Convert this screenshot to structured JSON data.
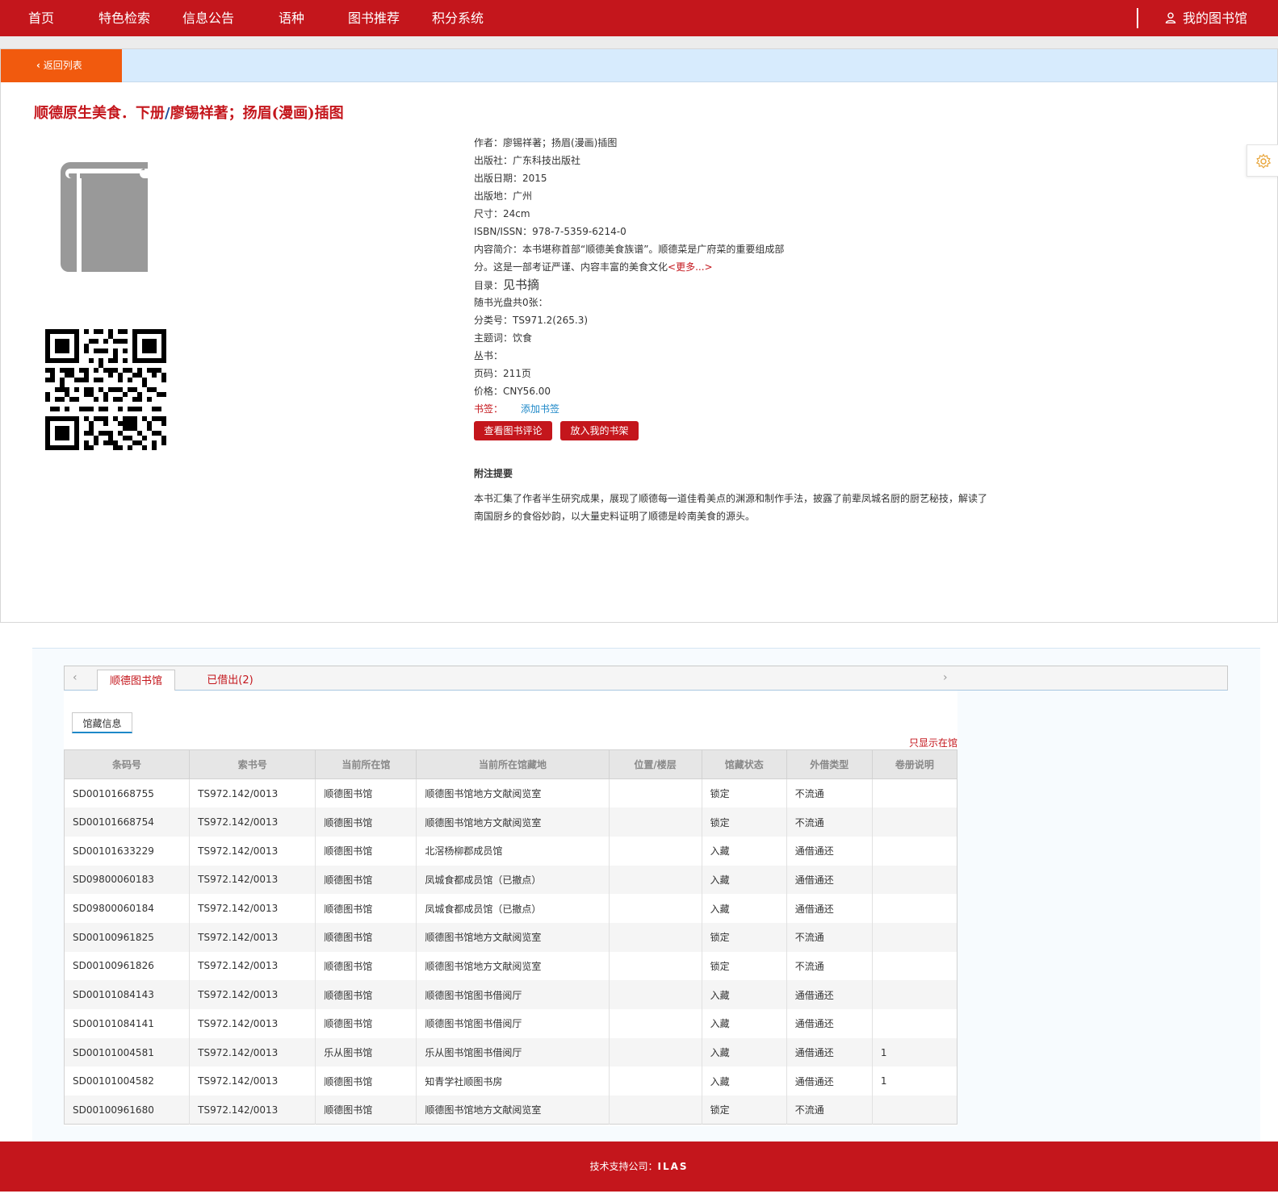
{
  "nav": {
    "items": [
      {
        "label": "首页",
        "name": "nav-home"
      },
      {
        "label": "特色检索",
        "name": "nav-special-search"
      },
      {
        "label": "信息公告",
        "name": "nav-announcements"
      },
      {
        "label": "语种",
        "name": "nav-language"
      },
      {
        "label": "图书推荐",
        "name": "nav-book-recommend"
      },
      {
        "label": "积分系统",
        "name": "nav-points"
      }
    ],
    "my_library": "我的图书馆"
  },
  "back_label": "返回列表",
  "book": {
    "title_main": "顺德原生美食．下册",
    "title_slash": "/",
    "title_author": "廖锡祥著；扬眉(漫画)插图"
  },
  "meta": {
    "author": "作者：廖锡祥著；扬眉(漫画)插图",
    "publisher": "出版社：广东科技出版社",
    "pub_date": "出版日期：2015",
    "pub_place": "出版地：广州",
    "size": "尺寸：24cm",
    "isbn": "ISBN/ISSN：978-7-5359-6214-0",
    "summary_1": "内容简介：本书堪称首部“顺德美食族谱”。顺德菜是广府菜的重要组成部",
    "summary_2": "分。这是一部考证严谨、内容丰富的美食文化",
    "more": "<更多...>",
    "toc_label": "目录：",
    "toc_value": "见书摘",
    "disc": "随书光盘共0张：",
    "class_no": "分类号：TS971.2(265.3)",
    "subject": "主题词：饮食",
    "series": "丛书：",
    "pages": "页码：211页",
    "price": "价格：CNY56.00",
    "bookmark_label": "书签：",
    "bookmark_add": "添加书签"
  },
  "actions": {
    "view_reviews": "查看图书评论",
    "add_shelf": "放入我的书架"
  },
  "notes": {
    "title": "附注提要",
    "text": "本书汇集了作者半生研究成果，展现了顺德每一道佳肴美点的渊源和制作手法，披露了前辈凤城名厨的厨艺秘技，解读了南国厨乡的食俗妙韵，以大量史料证明了顺德是岭南美食的源头。"
  },
  "holdings": {
    "tabs": [
      {
        "label": "顺德图书馆",
        "active": true
      },
      {
        "label": "已借出(2)",
        "active": false
      }
    ],
    "subtab": "馆藏信息",
    "only_show": "只显示在馆",
    "columns": [
      "条码号",
      "索书号",
      "当前所在馆",
      "当前所在馆藏地",
      "位置/楼层",
      "馆藏状态",
      "外借类型",
      "卷册说明"
    ],
    "rows": [
      [
        "SD00101668755",
        "TS972.142/0013",
        "顺德图书馆",
        "顺德图书馆地方文献阅览室",
        "",
        "锁定",
        "不流通",
        ""
      ],
      [
        "SD00101668754",
        "TS972.142/0013",
        "顺德图书馆",
        "顺德图书馆地方文献阅览室",
        "",
        "锁定",
        "不流通",
        ""
      ],
      [
        "SD00101633229",
        "TS972.142/0013",
        "顺德图书馆",
        "北滘杨柳郡成员馆",
        "",
        "入藏",
        "通借通还",
        ""
      ],
      [
        "SD09800060183",
        "TS972.142/0013",
        "顺德图书馆",
        "凤城食都成员馆（已撤点）",
        "",
        "入藏",
        "通借通还",
        ""
      ],
      [
        "SD09800060184",
        "TS972.142/0013",
        "顺德图书馆",
        "凤城食都成员馆（已撤点）",
        "",
        "入藏",
        "通借通还",
        ""
      ],
      [
        "SD00100961825",
        "TS972.142/0013",
        "顺德图书馆",
        "顺德图书馆地方文献阅览室",
        "",
        "锁定",
        "不流通",
        ""
      ],
      [
        "SD00100961826",
        "TS972.142/0013",
        "顺德图书馆",
        "顺德图书馆地方文献阅览室",
        "",
        "锁定",
        "不流通",
        ""
      ],
      [
        "SD00101084143",
        "TS972.142/0013",
        "顺德图书馆",
        "顺德图书馆图书借阅厅",
        "",
        "入藏",
        "通借通还",
        ""
      ],
      [
        "SD00101084141",
        "TS972.142/0013",
        "顺德图书馆",
        "顺德图书馆图书借阅厅",
        "",
        "入藏",
        "通借通还",
        ""
      ],
      [
        "SD00101004581",
        "TS972.142/0013",
        "乐从图书馆",
        "乐从图书馆图书借阅厅",
        "",
        "入藏",
        "通借通还",
        "1"
      ],
      [
        "SD00101004582",
        "TS972.142/0013",
        "顺德图书馆",
        "知青学社顺图书房",
        "",
        "入藏",
        "通借通还",
        "1"
      ],
      [
        "SD00100961680",
        "TS972.142/0013",
        "顺德图书馆",
        "顺德图书馆地方文献阅览室",
        "",
        "锁定",
        "不流通",
        ""
      ]
    ]
  },
  "footer": {
    "label": "技术支持公司：",
    "brand": "ILAS"
  }
}
